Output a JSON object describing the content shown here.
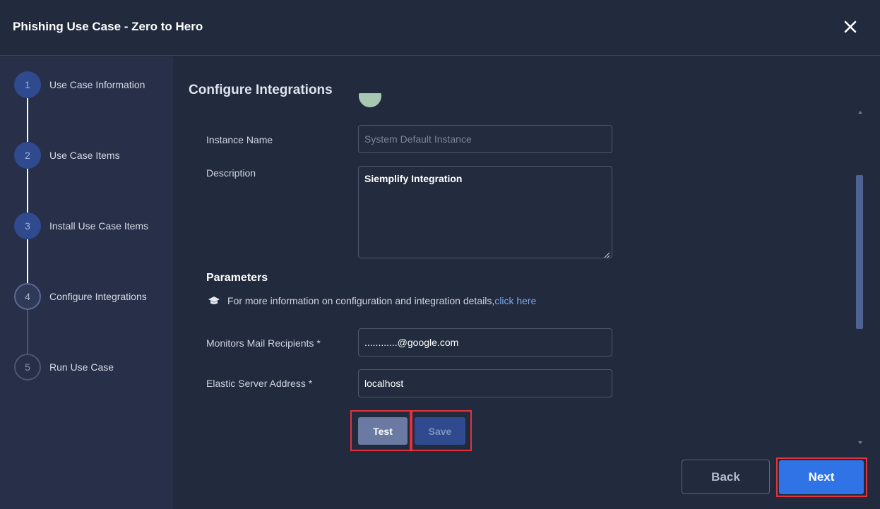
{
  "window": {
    "title": "Phishing Use Case - Zero to Hero"
  },
  "steps": [
    {
      "number": "1",
      "label": "Use Case Information",
      "state": "completed"
    },
    {
      "number": "2",
      "label": "Use Case Items",
      "state": "completed"
    },
    {
      "number": "3",
      "label": "Install Use Case Items",
      "state": "completed"
    },
    {
      "number": "4",
      "label": "Configure Integrations",
      "state": "current"
    },
    {
      "number": "5",
      "label": "Run Use Case",
      "state": "pending"
    }
  ],
  "main": {
    "title": "Configure Integrations",
    "instance_name": {
      "label": "Instance Name",
      "placeholder": "System Default Instance"
    },
    "description": {
      "label": "Description",
      "value": "Siemplify Integration"
    },
    "parameters": {
      "heading": "Parameters",
      "info_text": "For more information on configuration and integration details, ",
      "info_link": "click here"
    },
    "fields": [
      {
        "label": "Monitors Mail Recipients *",
        "value": "............@google.com"
      },
      {
        "label": "Elastic Server Address *",
        "value": "localhost"
      }
    ],
    "test_label": "Test",
    "save_label": "Save"
  },
  "footer": {
    "back_label": "Back",
    "next_label": "Next"
  },
  "colors": {
    "background": "#222a3d",
    "sidebar": "#283049",
    "step_completed": "#2f4a8e",
    "primary_button": "#2f73e6",
    "link": "#7aa6ee",
    "highlight": "#e2333d"
  },
  "icons": [
    "close-icon",
    "graduation-cap-icon",
    "scroll-up-arrow-icon",
    "scroll-down-arrow-icon",
    "resize-handle-icon"
  ]
}
